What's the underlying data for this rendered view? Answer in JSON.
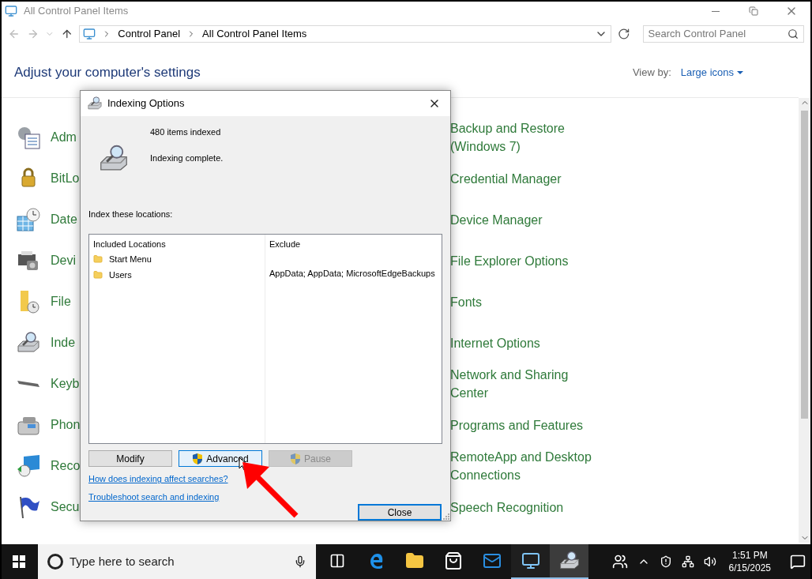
{
  "window": {
    "title": "All Control Panel Items"
  },
  "address": {
    "crumbs": [
      "Control Panel",
      "All Control Panel Items"
    ],
    "search": {
      "placeholder": "Search Control Panel"
    }
  },
  "header": {
    "title": "Adjust your computer's settings",
    "view_by_label": "View by:",
    "view_by_value": "Large icons"
  },
  "left_items": [
    {
      "label": "Adm"
    },
    {
      "label": "BitLo"
    },
    {
      "label": "Date"
    },
    {
      "label": "Devi"
    },
    {
      "label": "File"
    },
    {
      "label": "Inde"
    },
    {
      "label": "Keyb"
    },
    {
      "label": "Phon"
    },
    {
      "label": "Reco"
    },
    {
      "label": "Secu"
    }
  ],
  "right_items": [
    {
      "lines": [
        "Backup and Restore",
        "(Windows 7)"
      ]
    },
    {
      "lines": [
        "Credential Manager"
      ]
    },
    {
      "lines": [
        "Device Manager"
      ]
    },
    {
      "lines": [
        "File Explorer Options"
      ]
    },
    {
      "lines": [
        "Fonts"
      ]
    },
    {
      "lines": [
        "Internet Options"
      ]
    },
    {
      "lines": [
        "Network and Sharing",
        "Center"
      ]
    },
    {
      "lines": [
        "Programs and Features"
      ]
    },
    {
      "lines": [
        "RemoteApp and Desktop",
        "Connections"
      ]
    },
    {
      "lines": [
        "Speech Recognition"
      ]
    }
  ],
  "dialog": {
    "title": "Indexing Options",
    "items_indexed": "480 items indexed",
    "status": "Indexing complete.",
    "locations_label": "Index these locations:",
    "columns": [
      "Included Locations",
      "Exclude"
    ],
    "rows": [
      {
        "location": "Start Menu",
        "exclude": ""
      },
      {
        "location": "Users",
        "exclude": "AppData; AppData; MicrosoftEdgeBackups"
      }
    ],
    "buttons": [
      {
        "label": "Modify",
        "shield": false,
        "disabled": false
      },
      {
        "label": "Advanced",
        "shield": true,
        "disabled": false
      },
      {
        "label": "Pause",
        "shield": true,
        "disabled": true
      }
    ],
    "links": [
      "How does indexing affect searches?",
      "Troubleshoot search and indexing"
    ],
    "close_button": "Close"
  },
  "taskbar": {
    "search": {
      "placeholder": "Type here to search"
    },
    "apps": [
      {
        "kind": "taskview",
        "running": false,
        "selected": false
      },
      {
        "kind": "edge",
        "running": false,
        "selected": false
      },
      {
        "kind": "explorer",
        "running": false,
        "selected": false
      },
      {
        "kind": "store",
        "running": false,
        "selected": false
      },
      {
        "kind": "mail",
        "running": false,
        "selected": false
      },
      {
        "kind": "controlpanel",
        "running": true,
        "selected": false
      },
      {
        "kind": "indexing",
        "running": true,
        "selected": true
      }
    ],
    "time": "1:51 PM",
    "date": "6/15/2025"
  }
}
